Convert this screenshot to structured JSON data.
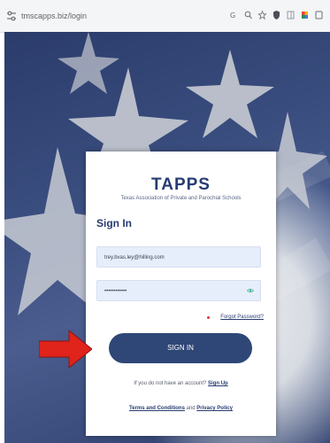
{
  "browser": {
    "url": "tmscapps.biz/login",
    "icons": [
      "translate-icon",
      "zoom-icon",
      "star-icon",
      "shield-extension-icon",
      "sidebar-icon",
      "color-extension-icon",
      "profile-icon"
    ]
  },
  "login": {
    "logo": "TAPPS",
    "subtitle": "Texas Association of Private and Parochial Schools",
    "heading": "Sign In",
    "email_value": "trey.bvas.ley@hilling.com",
    "password_value": "••••••••••••",
    "forgot_label": "Forgot Password?",
    "signin_label": "SIGN IN",
    "no_account_text": "If you do not have an account?",
    "signup_label": "Sign Up",
    "terms_label": "Terms and Conditions",
    "and_text": "and",
    "privacy_label": "Privacy Policy"
  },
  "colors": {
    "brand": "#283c72",
    "button": "#2f4777",
    "field_bg": "#e7eefb",
    "arrow": "#e0231b",
    "eye": "#3bb08f"
  }
}
